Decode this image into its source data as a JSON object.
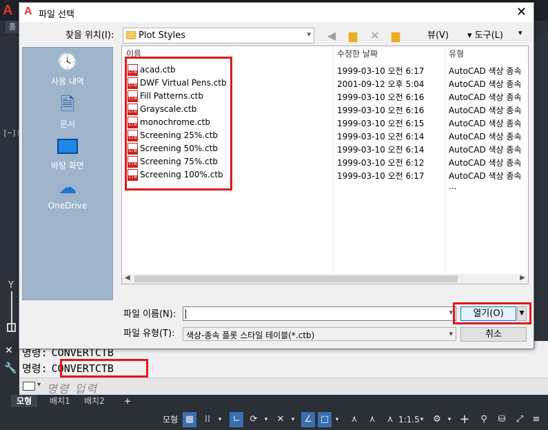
{
  "app": {
    "logo": "A",
    "tab_left": "홈",
    "view_label": "[−][",
    "ucs_axis_label": "Y"
  },
  "dialog": {
    "title": "파일 선택",
    "close_icon": "close-icon",
    "lookin_label": "찾을 위치(I):",
    "lookin_value": "Plot Styles",
    "views_label": "뷰(V)",
    "tools_label": "도구(L)",
    "places": [
      {
        "label": "사용 내역",
        "icon": "history-icon"
      },
      {
        "label": "문서",
        "icon": "documents-icon"
      },
      {
        "label": "바탕 화면",
        "icon": "desktop-icon"
      },
      {
        "label": "OneDrive",
        "icon": "onedrive-icon"
      }
    ],
    "columns": {
      "name": "이름",
      "date": "수정한 날짜",
      "type": "유형"
    },
    "files": [
      {
        "name": "acad.ctb",
        "date": "1999-03-10 오전 6:17",
        "type": "AutoCAD 색상 종속 ..."
      },
      {
        "name": "DWF Virtual Pens.ctb",
        "date": "2001-09-12 오후 5:04",
        "type": "AutoCAD 색상 종속 ..."
      },
      {
        "name": "Fill Patterns.ctb",
        "date": "1999-03-10 오전 6:16",
        "type": "AutoCAD 색상 종속 ..."
      },
      {
        "name": "Grayscale.ctb",
        "date": "1999-03-10 오전 6:16",
        "type": "AutoCAD 색상 종속 ..."
      },
      {
        "name": "monochrome.ctb",
        "date": "1999-03-10 오전 6:15",
        "type": "AutoCAD 색상 종속 ..."
      },
      {
        "name": "Screening 25%.ctb",
        "date": "1999-03-10 오전 6:14",
        "type": "AutoCAD 색상 종속 ..."
      },
      {
        "name": "Screening 50%.ctb",
        "date": "1999-03-10 오전 6:14",
        "type": "AutoCAD 색상 종속 ..."
      },
      {
        "name": "Screening 75%.ctb",
        "date": "1999-03-10 오전 6:12",
        "type": "AutoCAD 색상 종속 ..."
      },
      {
        "name": "Screening 100%.ctb",
        "date": "1999-03-10 오전 6:17",
        "type": "AutoCAD 색상 종속 ..."
      }
    ],
    "filename_label": "파일 이름(N):",
    "filename_value": "",
    "filetype_label": "파일 유형(T):",
    "filetype_value": "색상-종속 플롯 스타일 테이블(*.ctb)",
    "open_label": "열기(O)",
    "cancel_label": "취소"
  },
  "command": {
    "prompt_label": "명령:",
    "history_value": "CONVERTCTB",
    "current_value": "CONVERTCTB",
    "input_placeholder": "명령 입력"
  },
  "layout_tabs": [
    "모형",
    "배치1",
    "배치2",
    "+"
  ],
  "status_bar": {
    "model_label": "모형",
    "scale_label": "1:1.5"
  },
  "colors": {
    "highlight": "#e0161b",
    "places_bg": "#9fb3cb",
    "acad_dark": "#2b2f36"
  }
}
